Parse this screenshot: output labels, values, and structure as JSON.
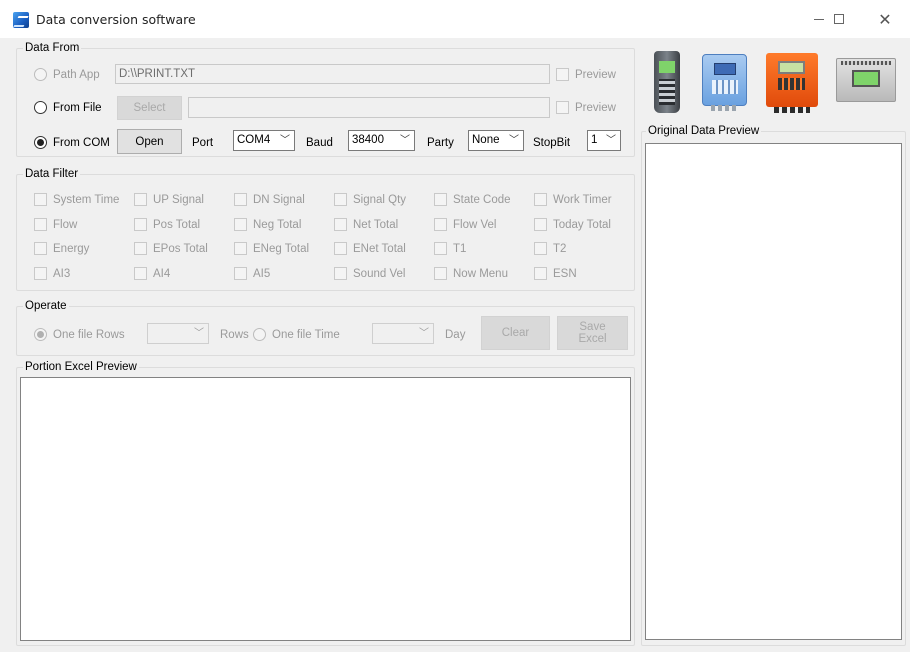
{
  "window": {
    "title": "Data conversion software",
    "controls": {
      "minimize": "—",
      "maximize": "□",
      "close": "✕"
    }
  },
  "data_from": {
    "group_title": "Data From",
    "path_app": {
      "label": "Path App",
      "value": "D:\\\\PRINT.TXT",
      "preview_label": "Preview"
    },
    "from_file": {
      "label": "From File",
      "select_label": "Select",
      "value": "",
      "preview_label": "Preview"
    },
    "from_com": {
      "label": "From COM",
      "open_label": "Open",
      "port_label": "Port",
      "port_value": "COM4",
      "baud_label": "Baud",
      "baud_value": "38400",
      "party_label": "Party",
      "party_value": "None",
      "stopbit_label": "StopBit",
      "stopbit_value": "1"
    },
    "selected": "from_com"
  },
  "data_filter": {
    "group_title": "Data Filter",
    "rows": [
      [
        "System Time",
        "UP Signal",
        "DN Signal",
        "Signal Qty",
        "State Code",
        "Work Timer"
      ],
      [
        "Flow",
        "Pos Total",
        "Neg Total",
        "Net Total",
        "Flow Vel",
        "Today Total"
      ],
      [
        "Energy",
        "EPos Total",
        "ENeg Total",
        "ENet Total",
        "T1",
        "T2"
      ],
      [
        "AI3",
        "AI4",
        "AI5",
        "Sound Vel",
        "Now Menu",
        "ESN"
      ]
    ]
  },
  "operate": {
    "group_title": "Operate",
    "one_file_rows_label": "One file Rows",
    "rows_value": "",
    "rows_label": "Rows",
    "one_file_time_label": "One file Time",
    "time_value": "",
    "day_label": "Day",
    "clear_label": "Clear",
    "save_excel_label": "Save\nExcel"
  },
  "portion_excel_preview": {
    "group_title": "Portion Excel Preview"
  },
  "original_data_preview": {
    "group_title": "Original Data Preview"
  },
  "device_images": [
    "handheld-flowmeter",
    "blue-wall-flowmeter",
    "orange-wall-flowmeter",
    "din-rail-flowmeter"
  ]
}
